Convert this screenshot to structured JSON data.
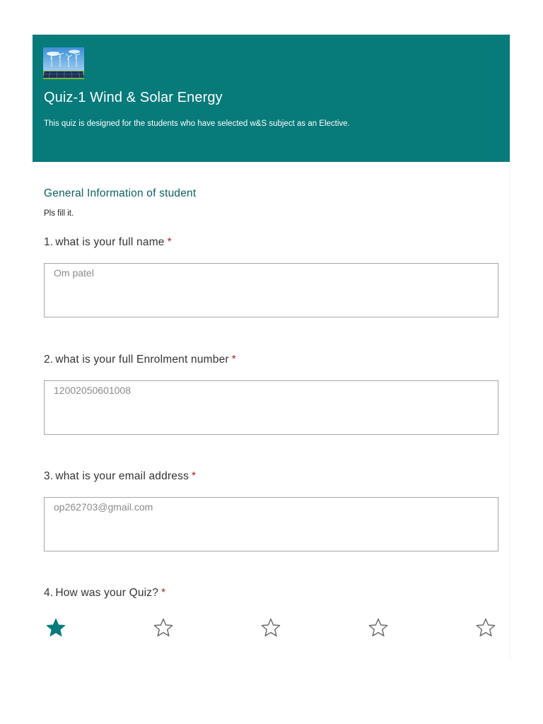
{
  "header": {
    "title": "Quiz-1 Wind & Solar Energy",
    "description": "This quiz is designed for the students who have selected w&S subject as an Elective.",
    "banner_color": "#077a7a"
  },
  "section": {
    "title": "General Information  of student",
    "description": "Pls fill it."
  },
  "questions": [
    {
      "number": "1.",
      "label": "what is your full name",
      "required": "*",
      "answer": "Om patel"
    },
    {
      "number": "2.",
      "label": "what is your full Enrolment number",
      "required": "*",
      "answer": "12002050601008"
    },
    {
      "number": "3.",
      "label": "what is your email address",
      "required": "*",
      "answer": "op262703@gmail.com"
    },
    {
      "number": "4.",
      "label": "How was your Quiz?",
      "required": "*"
    }
  ],
  "rating": {
    "max": 5,
    "value": 1,
    "icon": "star-icon",
    "filled_color": "#077a7a",
    "empty_color": "#666666"
  },
  "colors": {
    "accent": "#077a7a",
    "section_title": "#0d5f5f",
    "required": "#a4262c"
  }
}
